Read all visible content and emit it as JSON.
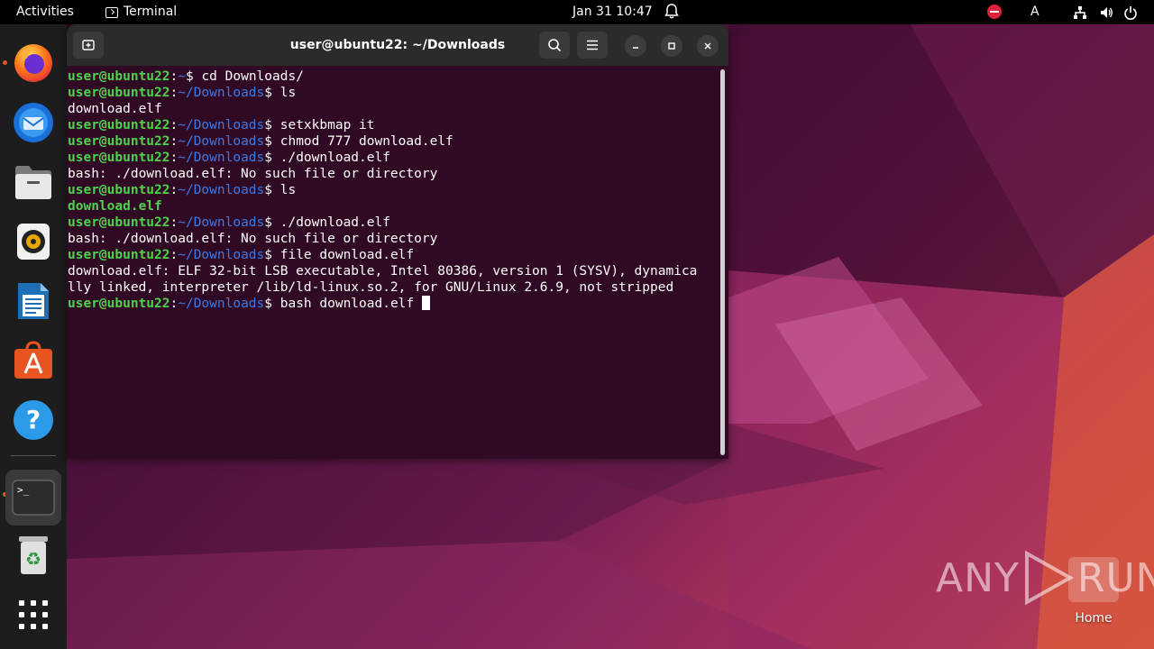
{
  "topbar": {
    "activities": "Activities",
    "app_name": "Terminal",
    "clock": "Jan 31  10:47",
    "lang": "A"
  },
  "dock": {
    "items": [
      "firefox",
      "thunderbird",
      "files",
      "rhythmbox",
      "libreoffice-writer",
      "app-center",
      "help",
      "terminal",
      "trash",
      "show-apps"
    ]
  },
  "window": {
    "title": "user@ubuntu22: ~/Downloads"
  },
  "terminal": {
    "lines": [
      {
        "type": "prompt",
        "user": "user@ubuntu22",
        "path": "~",
        "cmd": "cd Downloads/"
      },
      {
        "type": "prompt",
        "user": "user@ubuntu22",
        "path": "~/Downloads",
        "cmd": "ls"
      },
      {
        "type": "output",
        "text": "download.elf"
      },
      {
        "type": "prompt",
        "user": "user@ubuntu22",
        "path": "~/Downloads",
        "cmd": "setxkbmap it"
      },
      {
        "type": "prompt",
        "user": "user@ubuntu22",
        "path": "~/Downloads",
        "cmd": "chmod 777 download.elf"
      },
      {
        "type": "prompt",
        "user": "user@ubuntu22",
        "path": "~/Downloads",
        "cmd": "./download.elf"
      },
      {
        "type": "output",
        "text": "bash: ./download.elf: No such file or directory"
      },
      {
        "type": "prompt",
        "user": "user@ubuntu22",
        "path": "~/Downloads",
        "cmd": "ls"
      },
      {
        "type": "output-green",
        "text": "download.elf"
      },
      {
        "type": "prompt",
        "user": "user@ubuntu22",
        "path": "~/Downloads",
        "cmd": "./download.elf"
      },
      {
        "type": "output",
        "text": "bash: ./download.elf: No such file or directory"
      },
      {
        "type": "prompt",
        "user": "user@ubuntu22",
        "path": "~/Downloads",
        "cmd": "file download.elf"
      },
      {
        "type": "output",
        "text": "download.elf: ELF 32-bit LSB executable, Intel 80386, version 1 (SYSV), dynamica"
      },
      {
        "type": "output",
        "text": "lly linked, interpreter /lib/ld-linux.so.2, for GNU/Linux 2.6.9, not stripped"
      },
      {
        "type": "prompt",
        "user": "user@ubuntu22",
        "path": "~/Downloads",
        "cmd": "bash download.elf ",
        "cursor": true
      }
    ]
  },
  "watermark": {
    "text_left": "ANY",
    "text_right": "RUN"
  },
  "desktop": {
    "home_label": "Home"
  },
  "colors": {
    "terminal_bg": "#300a24",
    "prompt_user": "#4fd34f",
    "prompt_path": "#3a7ae8",
    "accent": "#e95420"
  }
}
